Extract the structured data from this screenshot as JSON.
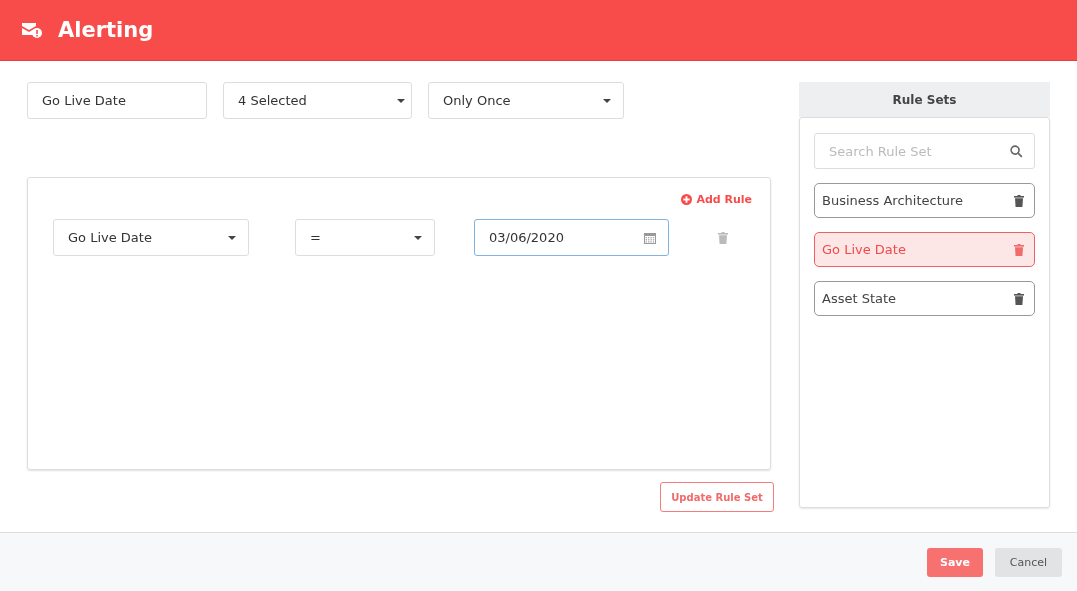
{
  "header": {
    "title": "Alerting"
  },
  "filters": [
    {
      "kind": "text",
      "value": "Go Live Date"
    },
    {
      "kind": "dropdown",
      "value": "4 Selected"
    },
    {
      "kind": "dropdown",
      "value": "Only Once"
    }
  ],
  "rules": {
    "add_label": "Add Rule",
    "rows": [
      {
        "field": "Go Live Date",
        "operator": "=",
        "value": "03/06/2020",
        "focused": true
      }
    ]
  },
  "update_button": "Update Rule Set",
  "rule_sets": {
    "title": "Rule Sets",
    "search": {
      "placeholder": "Search Rule Set"
    },
    "items": [
      {
        "label": "Business Architecture",
        "selected": false
      },
      {
        "label": "Go Live Date",
        "selected": true
      },
      {
        "label": "Asset State",
        "selected": false
      }
    ]
  },
  "footer": {
    "buttons": [
      {
        "label": "Save",
        "kind": "primary"
      },
      {
        "label": "Cancel",
        "kind": "secondary"
      }
    ]
  }
}
